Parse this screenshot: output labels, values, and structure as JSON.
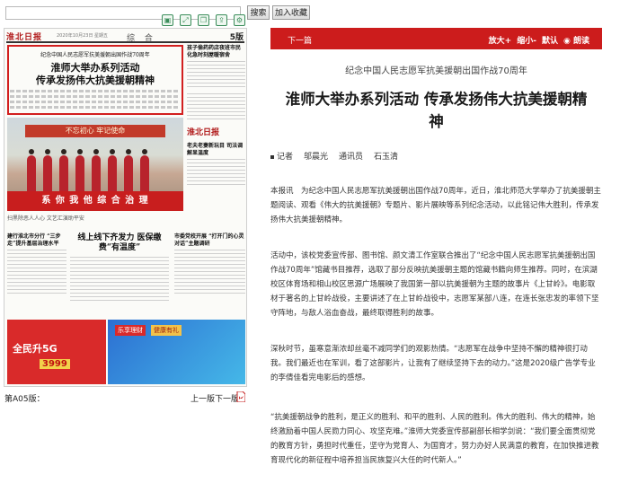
{
  "toolbar": {
    "search_placeholder": "",
    "search_button": "搜索",
    "favorite_button": "加入收藏",
    "icons": [
      "save-icon",
      "fullscreen-icon",
      "copy-icon",
      "share-icon",
      "settings-icon"
    ]
  },
  "newspaper": {
    "masthead": "淮北日报",
    "masthead_date": "2020年10月23日 星期五",
    "section": "综 合",
    "page_badge": "5版",
    "lead_subtitle": "纪念中国人民志愿军抗美援朝出国作战70周年",
    "lead_title_line1": "淮师大举办系列活动",
    "lead_title_line2": "传承发扬伟大抗美援朝精神",
    "photo_banner": "不忘初心 牢记使命",
    "photo_strip": "系 你 我 他   综 合 治 理",
    "caption": "扫黑除恶人人心 文艺汇演助平安",
    "side_title1": "孩子偷药药店夜班市民 化急时刻屋暖宿舍",
    "side_brand": "淮北日报",
    "side_title2": "老夫老妻新玩目 司法调解显温度",
    "bottom_left_title": "建行淮北市分行 “三步走”提升基层治理水平",
    "bottom_mid_title": "线上线下齐发力 医保缴费“有温度”",
    "bottom_right_title": "市委党校开展 “打开门的心灵对话”主题调研",
    "ad_left_line1": "全民升5G",
    "ad_left_line2": "3999",
    "ad_right_tag1": "乐享理财",
    "ad_right_tag2": "健康有礼"
  },
  "nav": {
    "page_label": "第A05版：",
    "prev": "上一版",
    "next": "下一版"
  },
  "article_bar": {
    "next_article": "下一篇",
    "enlarge": "放大+",
    "shrink": "缩小-",
    "default": "默认",
    "read": "朗读"
  },
  "article": {
    "subtitle": "纪念中国人民志愿军抗美援朝出国作战70周年",
    "title": "淮师大举办系列活动 传承发扬伟大抗美援朝精神",
    "byline_label": "记者",
    "reporter": "邬晨光",
    "correspondent_label": "通讯员",
    "correspondent": "石玉清",
    "paragraphs": [
      "本报讯　为纪念中国人民志愿军抗美援朝出国作战70周年，近日，淮北师范大学举办了抗美援朝主题阅读、观看《伟大的抗美援朝》专题片、影片展映等系列纪念活动，以此铭记伟大胜利，传承发扬伟大抗美援朝精神。",
      "活动中，该校党委宣传部、图书馆、颜文清工作室联合推出了“纪念中国人民志愿军抗美援朝出国作战70周年”馆藏书目推荐，选取了部分反映抗美援朝主题的馆藏书籍向师生推荐。同时，在滨湖校区体育场和相山校区思源广场展映了我国第一部以抗美援朝为主题的故事片《上甘岭》。电影取材于著名的上甘岭战役，主要讲述了在上甘岭战役中，志愿军某部八连，在连长张忠发的率领下坚守阵地，与敌人浴血奋战，最终取得胜利的故事。",
      "深秋时节，虽寒意渐浓却丝毫不减同学们的观影热情。“志愿军在战争中坚持不懈的精神很打动我。我们最近也在军训，看了这部影片，让我有了继续坚持下去的动力。”这是2020级广告学专业的李倩佳看完电影后的感想。",
      "“抗美援朝战争的胜利，是正义的胜利、和平的胜利、人民的胜利。伟大的胜利、伟大的精神，始终激励着中国人民勠力同心、攻坚克难。”淮师大党委宣传部副部长相学剑说：“我们要全面贯彻党的教育方针，勇担时代重任，坚守为党育人、为国育才，努力办好人民满意的教育，在加快推进教育现代化的新征程中培养担当民族复兴大任的时代新人。”"
    ]
  },
  "colors": {
    "accent_red": "#cc1c1c",
    "highlight_border": "#d21f1f"
  }
}
